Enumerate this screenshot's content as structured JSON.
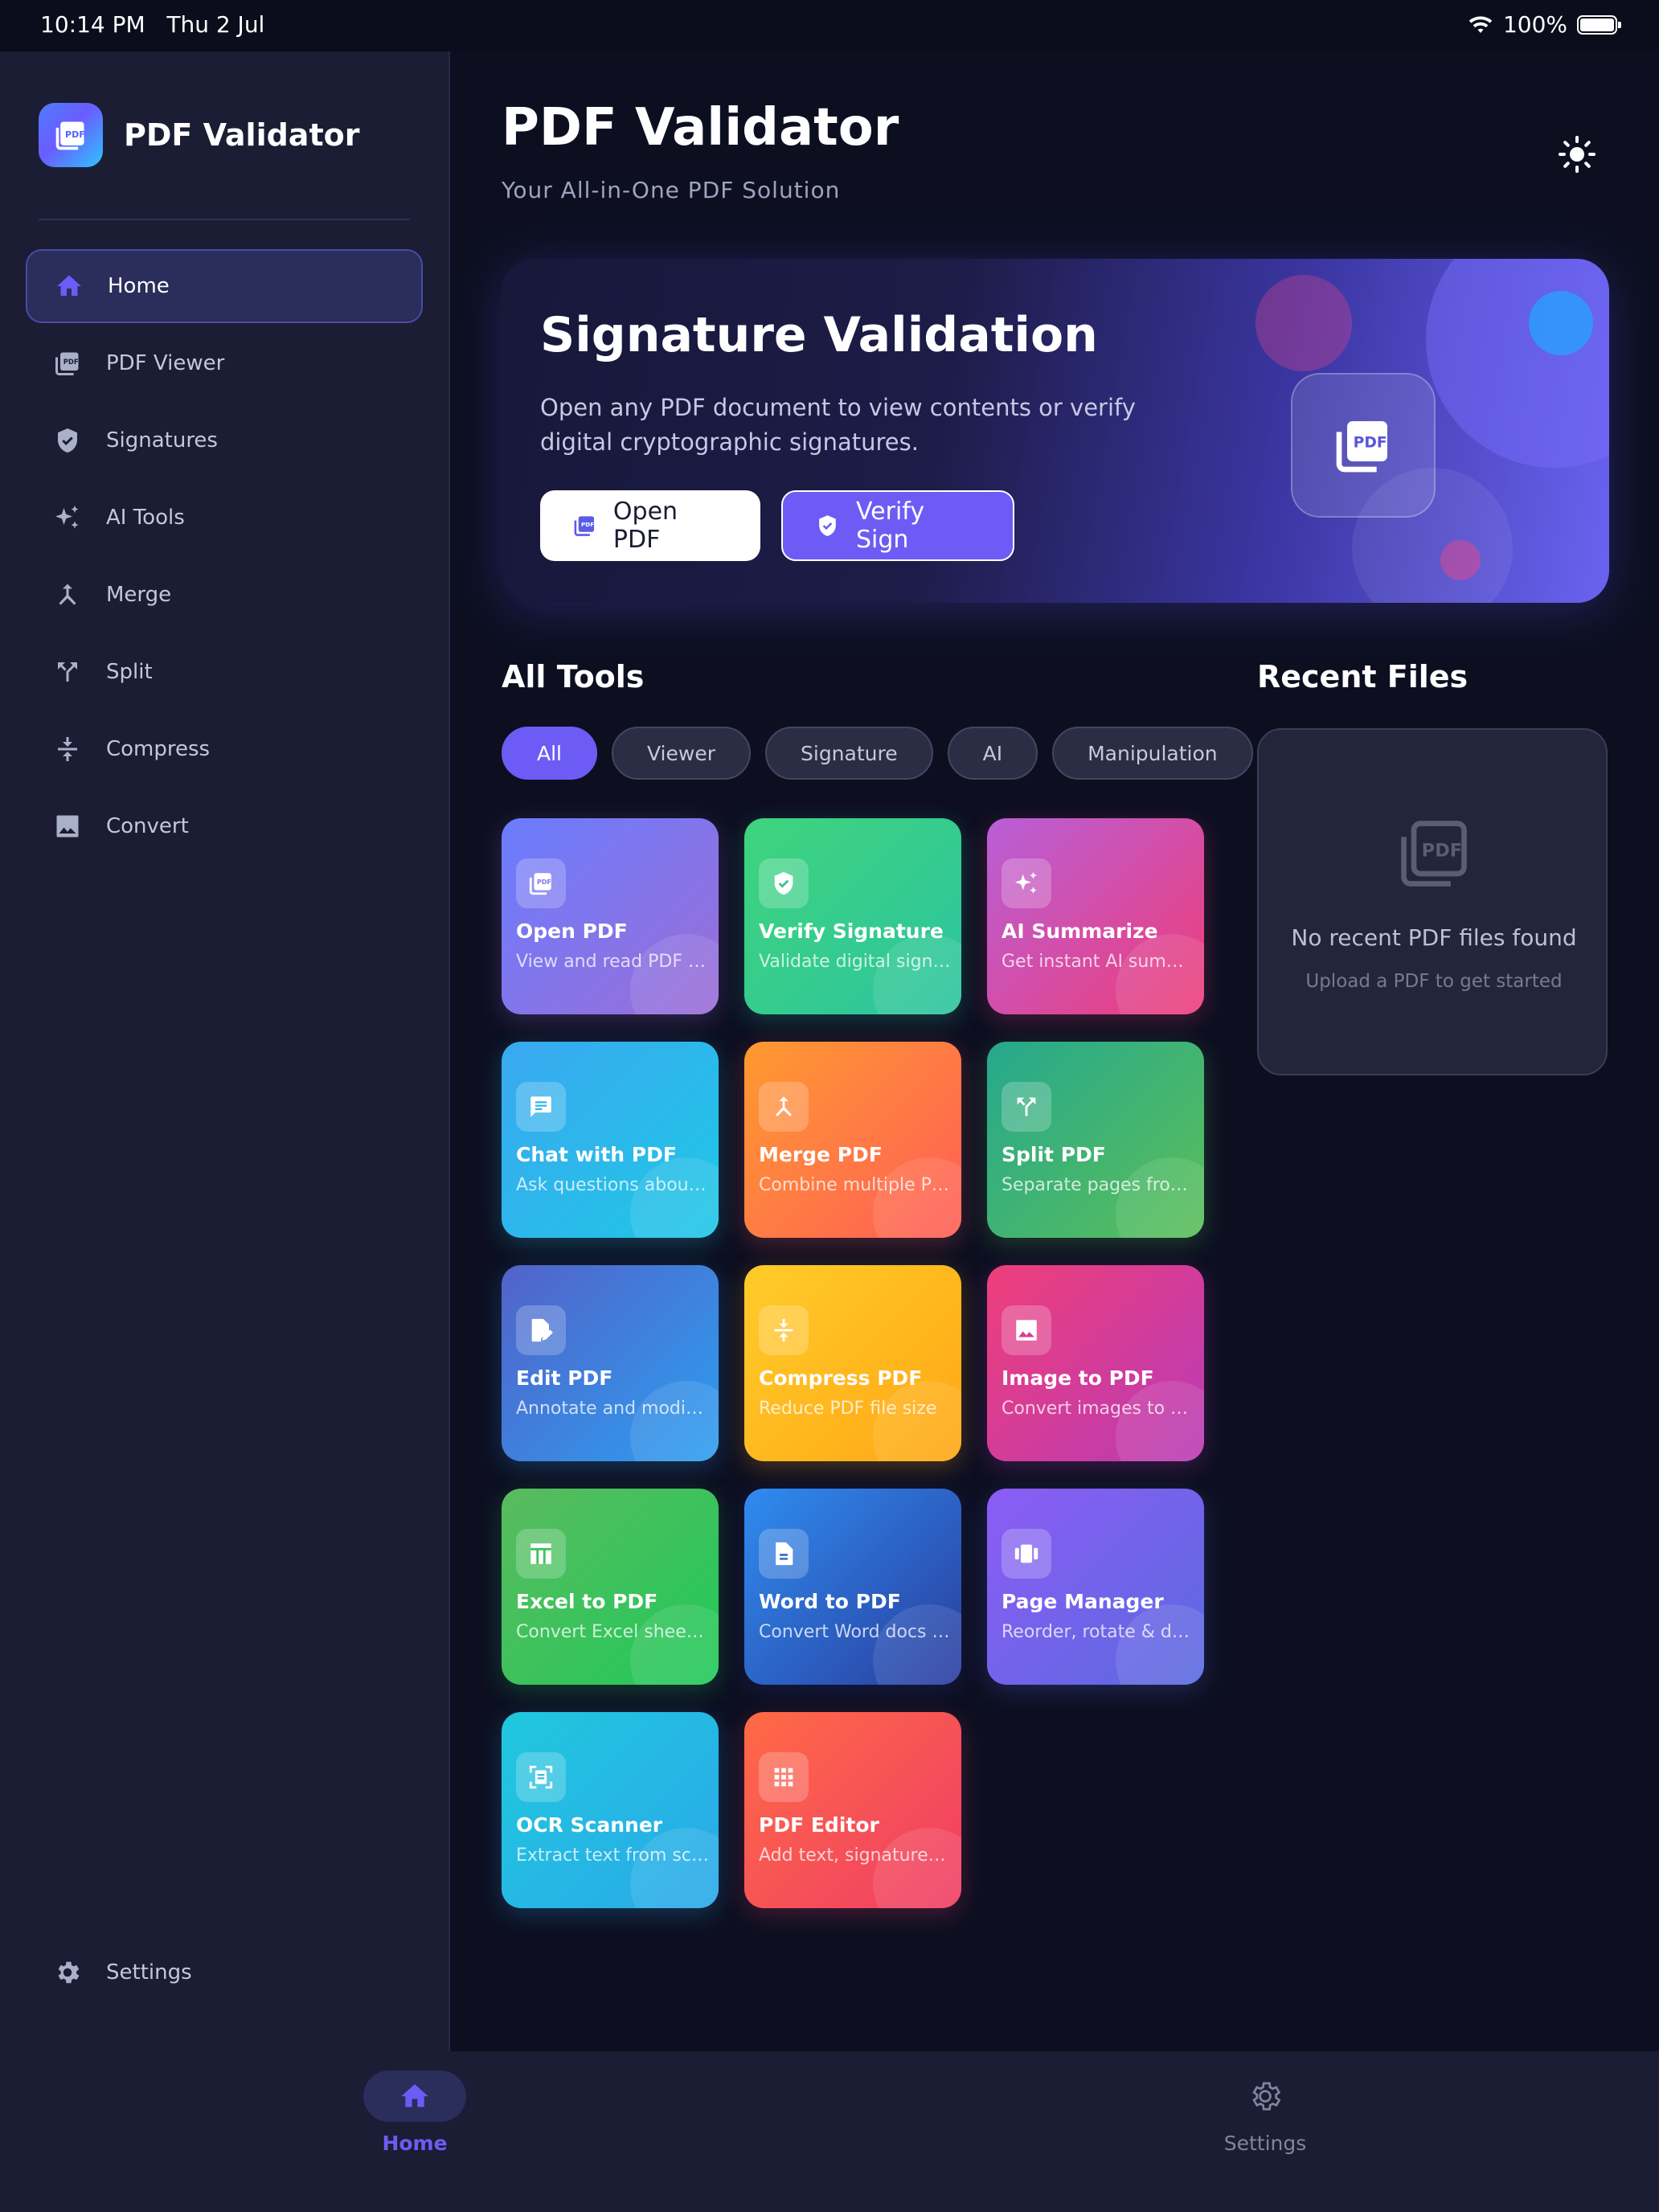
{
  "status_bar": {
    "time": "10:14 PM",
    "date": "Thu 2 Jul",
    "battery": "100%"
  },
  "sidebar": {
    "brand": "PDF Validator",
    "items": [
      {
        "label": "Home",
        "icon": "home-icon",
        "active": true
      },
      {
        "label": "PDF Viewer",
        "icon": "pdf-icon"
      },
      {
        "label": "Signatures",
        "icon": "shield-check-icon"
      },
      {
        "label": "AI Tools",
        "icon": "sparkle-icon"
      },
      {
        "label": "Merge",
        "icon": "merge-icon"
      },
      {
        "label": "Split",
        "icon": "split-icon"
      },
      {
        "label": "Compress",
        "icon": "compress-icon"
      },
      {
        "label": "Convert",
        "icon": "image-icon"
      }
    ],
    "settings_label": "Settings"
  },
  "header": {
    "title": "PDF Validator",
    "subtitle": "Your All-in-One PDF Solution",
    "theme_icon": "sun-icon"
  },
  "hero": {
    "title": "Signature Validation",
    "description": "Open any PDF document to view contents or verify digital cryptographic signatures.",
    "open_label": "Open PDF",
    "verify_label": "Verify Sign"
  },
  "tools": {
    "title": "All Tools",
    "filters": [
      "All",
      "Viewer",
      "Signature",
      "AI",
      "Manipulation"
    ],
    "active_filter": "All",
    "items": [
      {
        "name": "Open PDF",
        "desc": "View and read PDF files",
        "icon": "pdf-icon",
        "colors": [
          "#6a7dff",
          "#9b6dd6"
        ]
      },
      {
        "name": "Verify Signature",
        "desc": "Validate digital signatures",
        "icon": "shield-check-icon",
        "colors": [
          "#3fd47c",
          "#2cc4a0"
        ]
      },
      {
        "name": "AI Summarize",
        "desc": "Get instant AI summaries",
        "icon": "sparkle-icon",
        "colors": [
          "#b85fd8",
          "#ee3d78"
        ]
      },
      {
        "name": "Chat with PDF",
        "desc": "Ask questions about your PDF",
        "icon": "chat-icon",
        "colors": [
          "#3aa8f0",
          "#1fc7e6"
        ]
      },
      {
        "name": "Merge PDF",
        "desc": "Combine multiple PDFs",
        "icon": "merge-icon",
        "colors": [
          "#ff9a2f",
          "#ff5d58"
        ]
      },
      {
        "name": "Split PDF",
        "desc": "Separate pages from PDF",
        "icon": "split-icon",
        "colors": [
          "#26a88e",
          "#5bbf58"
        ]
      },
      {
        "name": "Edit PDF",
        "desc": "Annotate and modify PDFs",
        "icon": "edit-icon",
        "colors": [
          "#5262c9",
          "#2d9ef0"
        ]
      },
      {
        "name": "Compress PDF",
        "desc": "Reduce PDF file size",
        "icon": "compress-icon",
        "colors": [
          "#ffcc2a",
          "#ffa614"
        ]
      },
      {
        "name": "Image to PDF",
        "desc": "Convert images to PDF",
        "icon": "image-icon",
        "colors": [
          "#ef3e7a",
          "#b83bb6"
        ]
      },
      {
        "name": "Excel to PDF",
        "desc": "Convert Excel sheets to PDF",
        "icon": "table-icon",
        "colors": [
          "#5abb5e",
          "#20c95a"
        ]
      },
      {
        "name": "Word to PDF",
        "desc": "Convert Word docs to PDF",
        "icon": "document-icon",
        "colors": [
          "#2f8cf0",
          "#2a3c9e"
        ]
      },
      {
        "name": "Page Manager",
        "desc": "Reorder, rotate & delete pages",
        "icon": "pages-icon",
        "colors": [
          "#8c5cf5",
          "#5a6ae0"
        ]
      },
      {
        "name": "OCR Scanner",
        "desc": "Extract text from scanned PDFs",
        "icon": "scan-icon",
        "colors": [
          "#20c8dd",
          "#2aa8ea"
        ]
      },
      {
        "name": "PDF Editor",
        "desc": "Add text, signatures and more",
        "icon": "grid-icon",
        "colors": [
          "#ff6a45",
          "#ef3d66"
        ]
      }
    ]
  },
  "recent": {
    "title": "Recent Files",
    "empty_text": "No recent PDF files found",
    "empty_sub": "Upload a PDF to get started"
  },
  "bottom_nav": {
    "home_label": "Home",
    "settings_label": "Settings"
  },
  "colors": {
    "accent": "#6c5cf5",
    "background": "#0d0f21",
    "sidebar": "#1a1d33"
  }
}
